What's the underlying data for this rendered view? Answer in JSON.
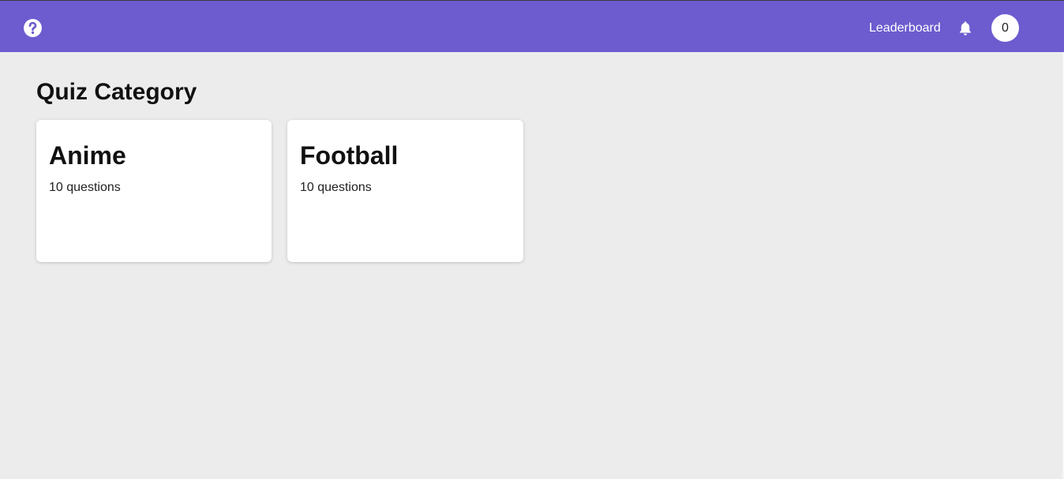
{
  "header": {
    "leaderboard_label": "Leaderboard",
    "avatar_text": "0",
    "icons": {
      "help": "help-circle-icon",
      "notifications": "bell-icon"
    },
    "colors": {
      "navbar": "#6c5ccf",
      "text": "#ffffff"
    }
  },
  "main": {
    "title": "Quiz Category",
    "categories": [
      {
        "name": "Anime",
        "count_label": "10 questions"
      },
      {
        "name": "Football",
        "count_label": "10 questions"
      }
    ]
  }
}
